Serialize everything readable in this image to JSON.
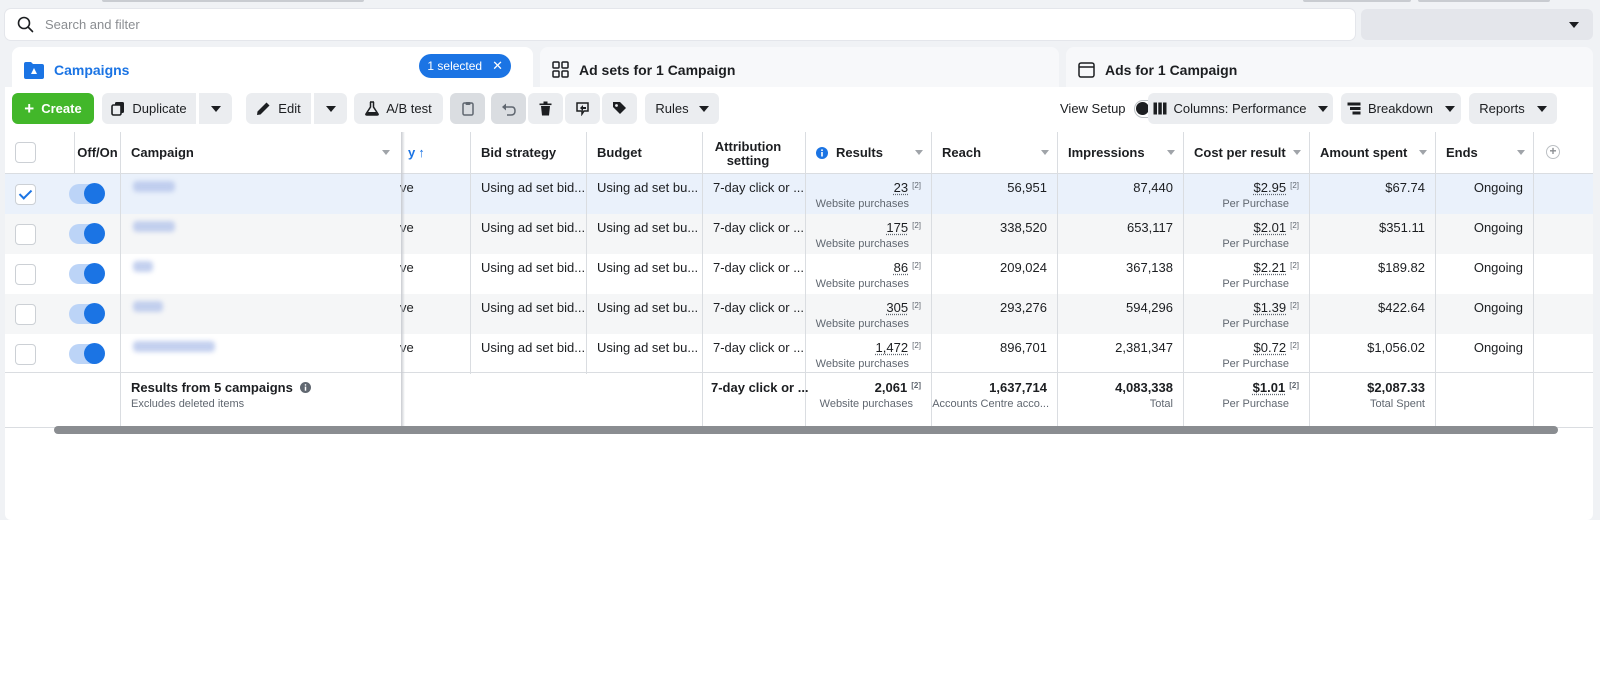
{
  "search": {
    "placeholder": "Search and filter"
  },
  "tabs": {
    "campaigns": {
      "label": "Campaigns",
      "selected_badge": "1 selected"
    },
    "adsets": {
      "label": "Ad sets for 1 Campaign"
    },
    "ads": {
      "label": "Ads for 1 Campaign"
    }
  },
  "toolbar": {
    "create": "Create",
    "duplicate": "Duplicate",
    "edit": "Edit",
    "ab_test": "A/B test",
    "rules": "Rules",
    "view_setup": "View Setup",
    "columns": "Columns: Performance",
    "breakdown": "Breakdown",
    "reports": "Reports"
  },
  "columns": {
    "off_on": "Off/On",
    "campaign": "Campaign",
    "delivery_partial": "y",
    "bid_strategy": "Bid strategy",
    "budget": "Budget",
    "attribution": "Attribution setting",
    "results": "Results",
    "reach": "Reach",
    "impressions": "Impressions",
    "cost_per_result": "Cost per result",
    "amount_spent": "Amount spent",
    "ends": "Ends"
  },
  "rows": [
    {
      "checked": true,
      "delivery": "ve",
      "bid": "Using ad set bid...",
      "budget": "Using ad set bu...",
      "attribution": "7-day click or ...",
      "results": "23",
      "results_sub": "Website purchases",
      "reach": "56,951",
      "impressions": "87,440",
      "cpr": "$2.95",
      "cpr_sub": "Per Purchase",
      "spent": "$67.74",
      "ends": "Ongoing"
    },
    {
      "checked": false,
      "delivery": "ve",
      "bid": "Using ad set bid...",
      "budget": "Using ad set bu...",
      "attribution": "7-day click or ...",
      "results": "175",
      "results_sub": "Website purchases",
      "reach": "338,520",
      "impressions": "653,117",
      "cpr": "$2.01",
      "cpr_sub": "Per Purchase",
      "spent": "$351.11",
      "ends": "Ongoing"
    },
    {
      "checked": false,
      "delivery": "ve",
      "bid": "Using ad set bid...",
      "budget": "Using ad set bu...",
      "attribution": "7-day click or ...",
      "results": "86",
      "results_sub": "Website purchases",
      "reach": "209,024",
      "impressions": "367,138",
      "cpr": "$2.21",
      "cpr_sub": "Per Purchase",
      "spent": "$189.82",
      "ends": "Ongoing"
    },
    {
      "checked": false,
      "delivery": "ve",
      "bid": "Using ad set bid...",
      "budget": "Using ad set bu...",
      "attribution": "7-day click or ...",
      "results": "305",
      "results_sub": "Website purchases",
      "reach": "293,276",
      "impressions": "594,296",
      "cpr": "$1.39",
      "cpr_sub": "Per Purchase",
      "spent": "$422.64",
      "ends": "Ongoing"
    },
    {
      "checked": false,
      "delivery": "ve",
      "bid": "Using ad set bid...",
      "budget": "Using ad set bu...",
      "attribution": "7-day click or ...",
      "results": "1,472",
      "results_sub": "Website purchases",
      "reach": "896,701",
      "impressions": "2,381,347",
      "cpr": "$0.72",
      "cpr_sub": "Per Purchase",
      "spent": "$1,056.02",
      "ends": "Ongoing"
    }
  ],
  "footnote_marker": "[2]",
  "summary": {
    "title": "Results from 5 campaigns",
    "subtitle": "Excludes deleted items",
    "attribution": "7-day click or ...",
    "results": "2,061",
    "results_sub": "Website purchases",
    "reach": "1,637,714",
    "reach_sub": "Accounts Centre acco...",
    "impressions": "4,083,338",
    "impressions_sub": "Total",
    "cpr": "$1.01",
    "cpr_sub": "Per Purchase",
    "spent": "$2,087.33",
    "spent_sub": "Total Spent"
  },
  "colors": {
    "accent": "#1b74e4",
    "create": "#42b72a"
  }
}
